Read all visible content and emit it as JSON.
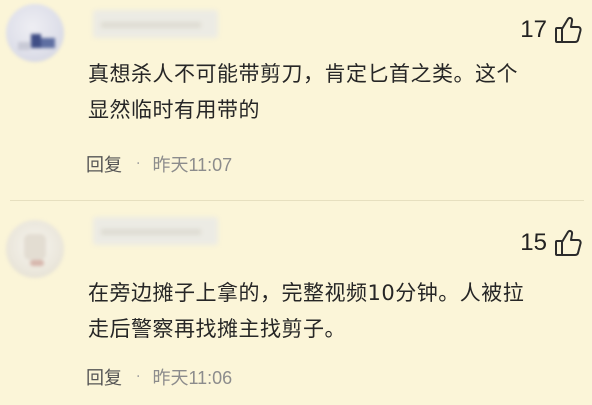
{
  "comments": [
    {
      "likes": "17",
      "text_lines": [
        "真想杀人不可能带剪刀，肯定匕首之类。这个",
        "显然临时有用带的"
      ],
      "reply_label": "回复",
      "separator": "·",
      "time": "昨天11:07"
    },
    {
      "likes": "15",
      "text_lines": [
        "在旁边摊子上拿的，完整视频10分钟。人被拉",
        "走后警察再找摊主找剪子。"
      ],
      "reply_label": "回复",
      "separator": "·",
      "time": "昨天11:06"
    }
  ],
  "icons": {
    "like": "thumbs-up-icon",
    "avatar": "user-avatar-blurred",
    "name": "username-blurred"
  },
  "colors": {
    "background": "#fbf5d8",
    "text": "#262626",
    "meta_text": "#8a8a8a",
    "divider": "#e6dfbf"
  }
}
